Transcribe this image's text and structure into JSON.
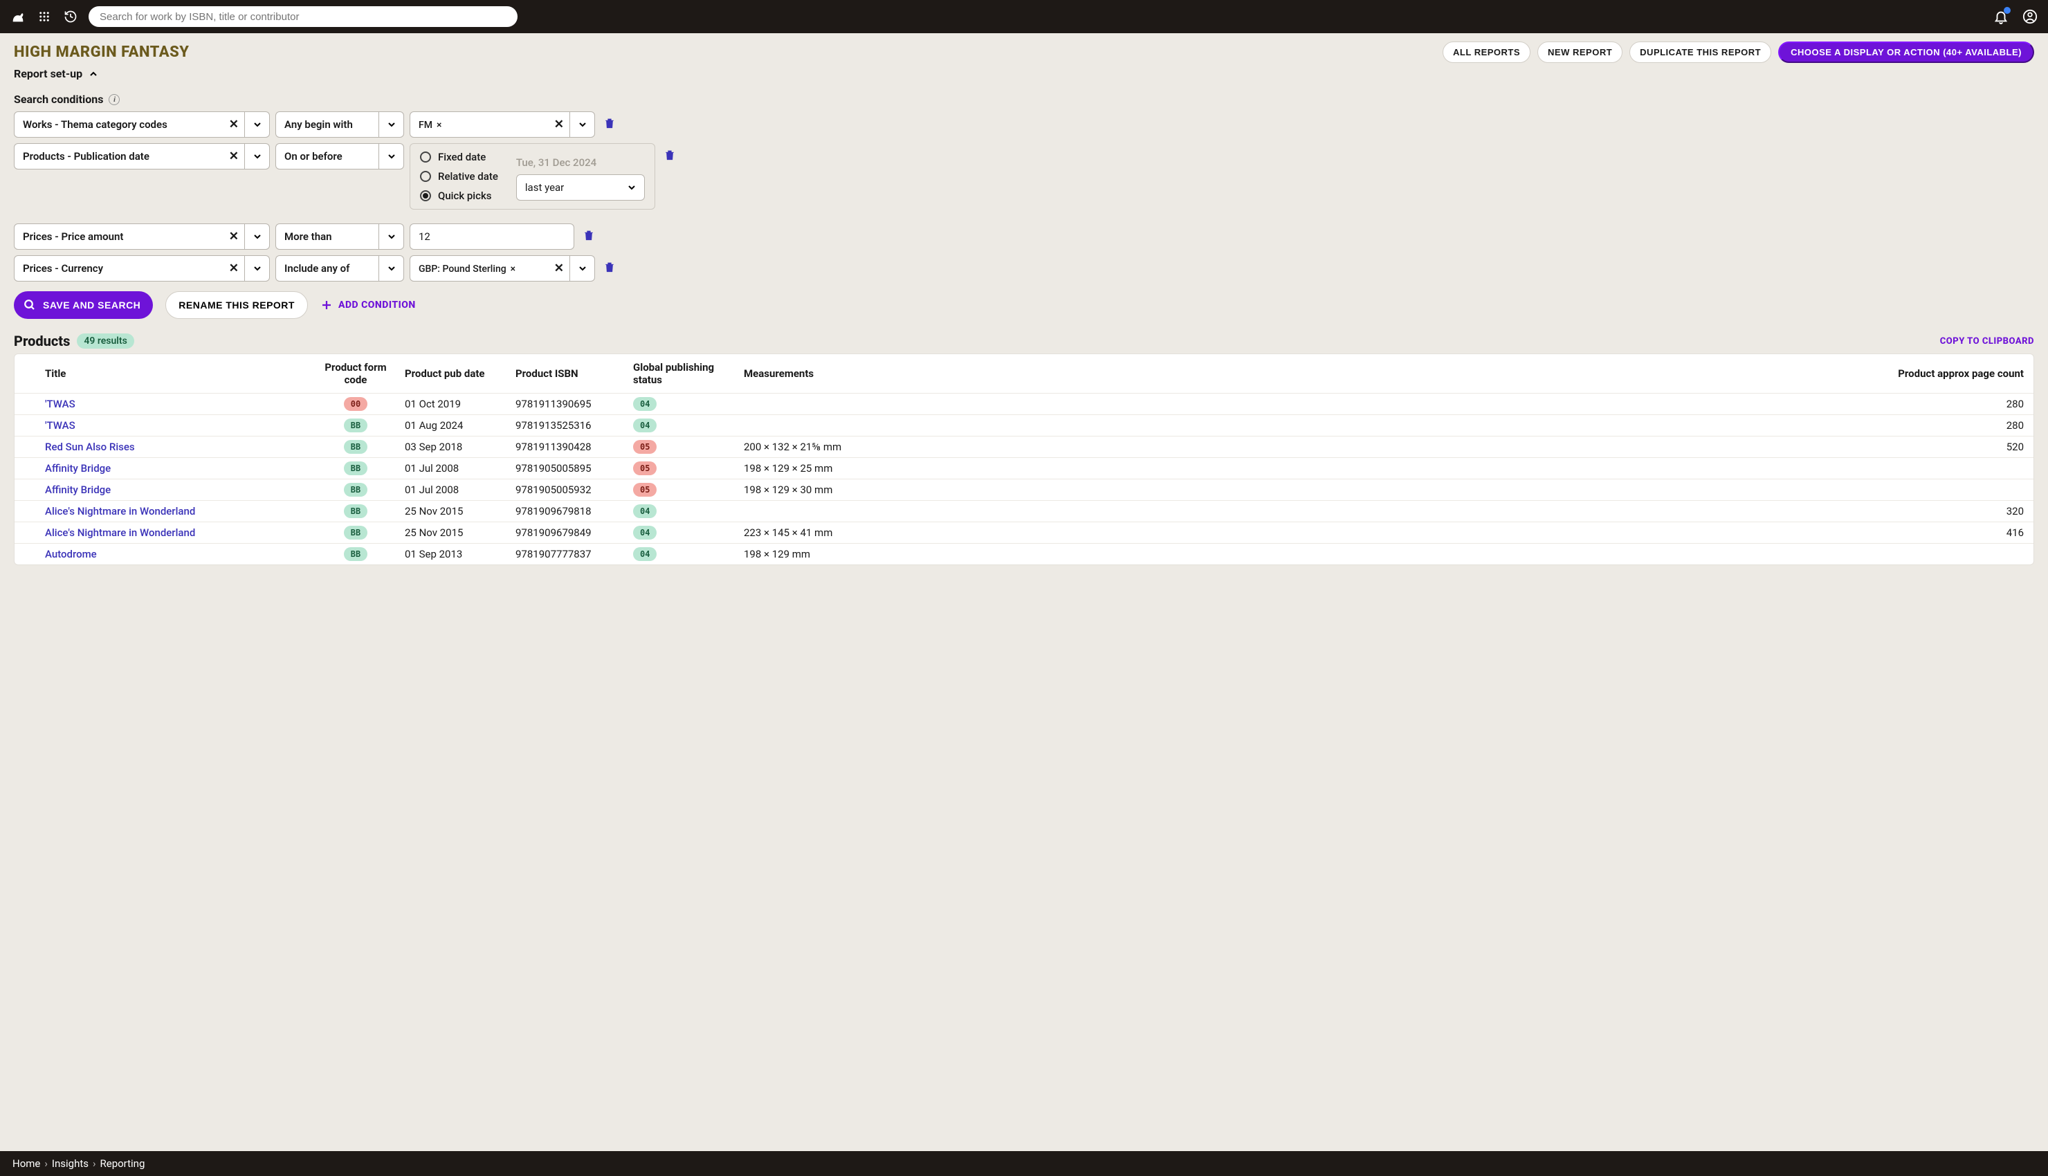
{
  "topbar": {
    "search_placeholder": "Search for work by ISBN, title or contributor"
  },
  "page": {
    "title": "HIGH MARGIN FANTASY",
    "actions": {
      "all_reports": "ALL REPORTS",
      "new_report": "NEW REPORT",
      "duplicate": "DUPLICATE THIS REPORT",
      "display": "CHOOSE A DISPLAY OR ACTION (40+ AVAILABLE)"
    },
    "setup_label": "Report set-up"
  },
  "conditions_label": "Search conditions",
  "conditions": [
    {
      "field": "Works - Thema category codes",
      "op": "Any begin with",
      "tag": "FM"
    },
    {
      "field": "Products - Publication date",
      "op": "On or before"
    },
    {
      "field": "Prices - Price amount",
      "op": "More than",
      "val": "12"
    },
    {
      "field": "Prices - Currency",
      "op": "Include any of",
      "tag": "GBP: Pound Sterling"
    }
  ],
  "date_panel": {
    "opt_fixed": "Fixed date",
    "opt_relative": "Relative date",
    "opt_quick": "Quick picks",
    "ghost": "Tue, 31 Dec 2024",
    "pick": "last year"
  },
  "cond_actions": {
    "save": "SAVE AND SEARCH",
    "rename": "RENAME THIS REPORT",
    "add": "ADD CONDITION"
  },
  "results": {
    "title": "Products",
    "badge": "49 results",
    "copy": "COPY TO CLIPBOARD",
    "columns": {
      "title": "Title",
      "form": "Product form code",
      "pub": "Product pub date",
      "isbn": "Product ISBN",
      "status": "Global publishing status",
      "meas": "Measurements",
      "pages": "Product approx page count"
    },
    "rows": [
      {
        "title": "'TWAS",
        "form": "00",
        "form_color": "red",
        "pub": "01 Oct 2019",
        "isbn": "9781911390695",
        "status": "04",
        "status_color": "grn",
        "meas": "",
        "pages": "280"
      },
      {
        "title": "'TWAS",
        "form": "BB",
        "form_color": "grn",
        "pub": "01 Aug 2024",
        "isbn": "9781913525316",
        "status": "04",
        "status_color": "grn",
        "meas": "",
        "pages": "280"
      },
      {
        "title": "Red Sun Also Rises",
        "form": "BB",
        "form_color": "grn",
        "pub": "03 Sep 2018",
        "isbn": "9781911390428",
        "status": "05",
        "status_color": "red",
        "meas": "200 × 132 × 21⅝ mm",
        "pages": "520"
      },
      {
        "title": "Affinity Bridge",
        "form": "BB",
        "form_color": "grn",
        "pub": "01 Jul 2008",
        "isbn": "9781905005895",
        "status": "05",
        "status_color": "red",
        "meas": "198 × 129 × 25 mm",
        "pages": ""
      },
      {
        "title": "Affinity Bridge",
        "form": "BB",
        "form_color": "grn",
        "pub": "01 Jul 2008",
        "isbn": "9781905005932",
        "status": "05",
        "status_color": "red",
        "meas": "198 × 129 × 30 mm",
        "pages": ""
      },
      {
        "title": "Alice's Nightmare in Wonderland",
        "form": "BB",
        "form_color": "grn",
        "pub": "25 Nov 2015",
        "isbn": "9781909679818",
        "status": "04",
        "status_color": "grn",
        "meas": "",
        "pages": "320"
      },
      {
        "title": "Alice's Nightmare in Wonderland",
        "form": "BB",
        "form_color": "grn",
        "pub": "25 Nov 2015",
        "isbn": "9781909679849",
        "status": "04",
        "status_color": "grn",
        "meas": "223 × 145 × 41 mm",
        "pages": "416"
      },
      {
        "title": "Autodrome",
        "form": "BB",
        "form_color": "grn",
        "pub": "01 Sep 2013",
        "isbn": "9781907777837",
        "status": "04",
        "status_color": "grn",
        "meas": "198 × 129 mm",
        "pages": ""
      }
    ]
  },
  "footer": {
    "home": "Home",
    "insights": "Insights",
    "reporting": "Reporting"
  }
}
